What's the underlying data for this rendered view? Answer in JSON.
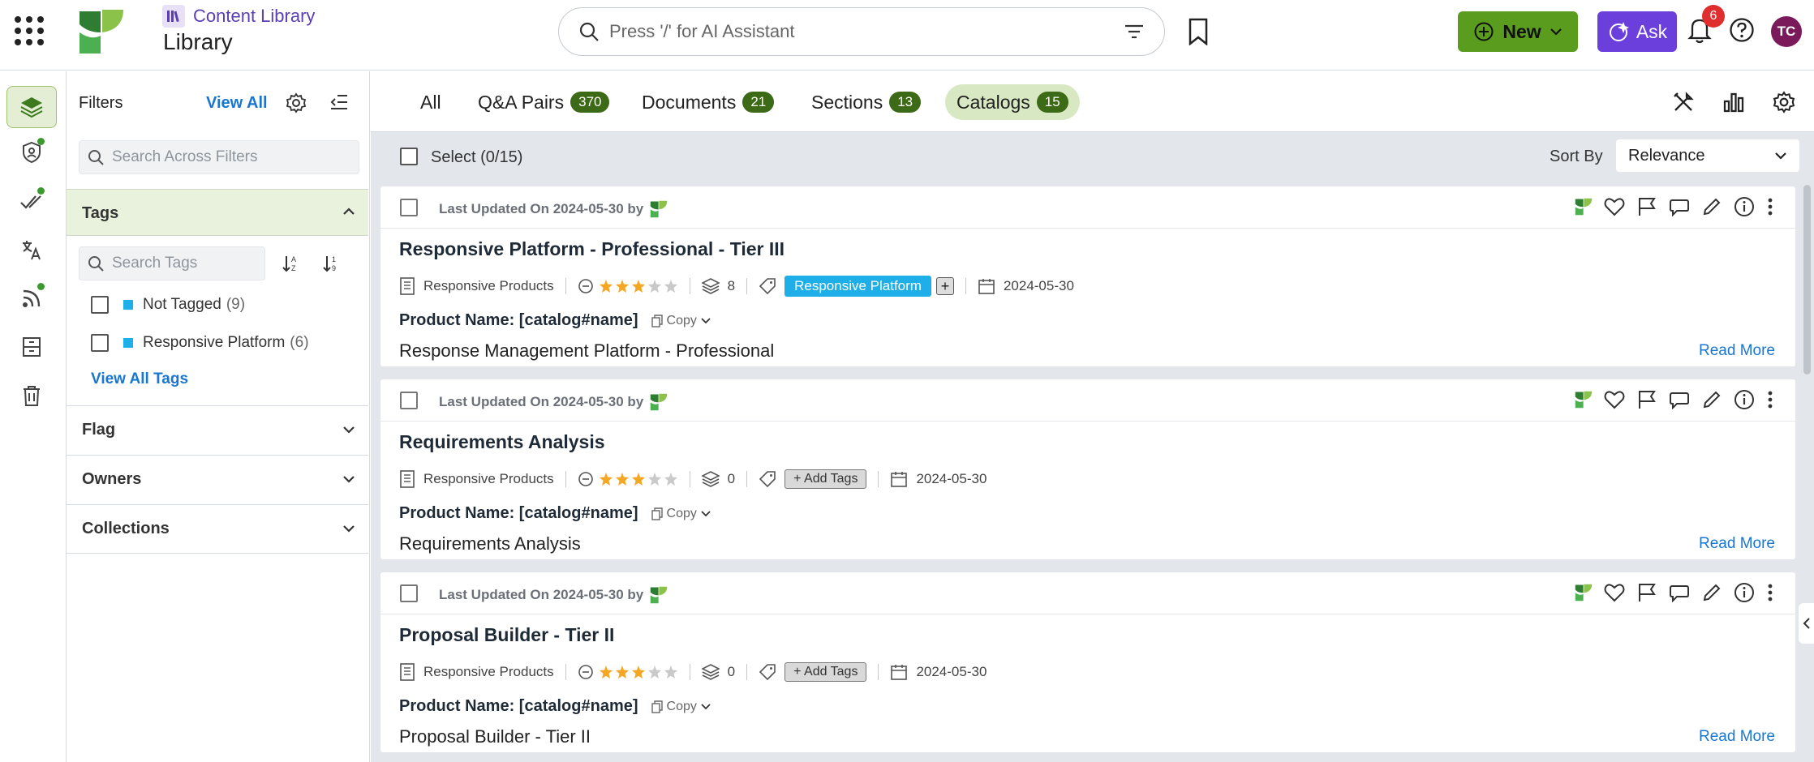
{
  "header": {
    "breadcrumb": "Content Library",
    "title": "Library",
    "search_placeholder": "Press '/' for AI Assistant",
    "new_label": "New",
    "ask_label": "Ask",
    "notification_count": "6",
    "avatar_initials": "TC"
  },
  "filters": {
    "heading": "Filters",
    "view_all": "View All",
    "search_placeholder": "Search Across Filters",
    "tags_section": {
      "title": "Tags",
      "search_placeholder": "Search Tags",
      "items": [
        {
          "label": "Not Tagged",
          "count": "(9)",
          "color": "#1eaee8"
        },
        {
          "label": "Responsive Platform",
          "count": "(6)",
          "color": "#1eaee8"
        }
      ],
      "view_all_tags": "View All Tags"
    },
    "sections": [
      "Flag",
      "Owners",
      "Collections"
    ]
  },
  "tabs": [
    {
      "label": "All",
      "count": ""
    },
    {
      "label": "Q&A Pairs",
      "count": "370"
    },
    {
      "label": "Documents",
      "count": "21"
    },
    {
      "label": "Sections",
      "count": "13"
    },
    {
      "label": "Catalogs",
      "count": "15",
      "active": true
    }
  ],
  "toolbar": {
    "select_label": "Select (0/15)",
    "sort_by_label": "Sort By",
    "sort_value": "Relevance"
  },
  "cards": [
    {
      "updated": "Last Updated On 2024-05-30 by",
      "title": "Responsive Platform - Professional - Tier III",
      "source": "Responsive Products",
      "rating": 3,
      "sections_count": "8",
      "tag": "Responsive Platform",
      "tag_plus": "+",
      "date": "2024-05-30",
      "product_label": "Product Name: [catalog#name]",
      "copy_label": "Copy",
      "description": "Response Management Platform - Professional",
      "read_more": "Read More"
    },
    {
      "updated": "Last Updated On 2024-05-30 by",
      "title": "Requirements Analysis",
      "source": "Responsive Products",
      "rating": 3,
      "sections_count": "0",
      "add_tags": "+ Add Tags",
      "date": "2024-05-30",
      "product_label": "Product Name: [catalog#name]",
      "copy_label": "Copy",
      "description": "Requirements Analysis",
      "read_more": "Read More"
    },
    {
      "updated": "Last Updated On 2024-05-30 by",
      "title": "Proposal Builder - Tier II",
      "source": "Responsive Products",
      "rating": 3,
      "sections_count": "0",
      "add_tags": "+ Add Tags",
      "date": "2024-05-30",
      "product_label": "Product Name: [catalog#name]",
      "copy_label": "Copy",
      "description": "Proposal Builder - Tier II",
      "read_more": "Read More"
    }
  ],
  "colors": {
    "brand_green": "#5a9c1e",
    "ask_purple": "#6a3fdc",
    "link_blue": "#1976d2",
    "tag_blue": "#1eaee8",
    "star_gold": "#f5a623"
  },
  "icons": {
    "apps": "apps-grid-icon",
    "logo": "responsive-logo-icon",
    "search": "search-icon",
    "filter": "filter-icon",
    "bookmark": "bookmark-icon",
    "bell": "bell-icon",
    "help": "help-icon"
  }
}
